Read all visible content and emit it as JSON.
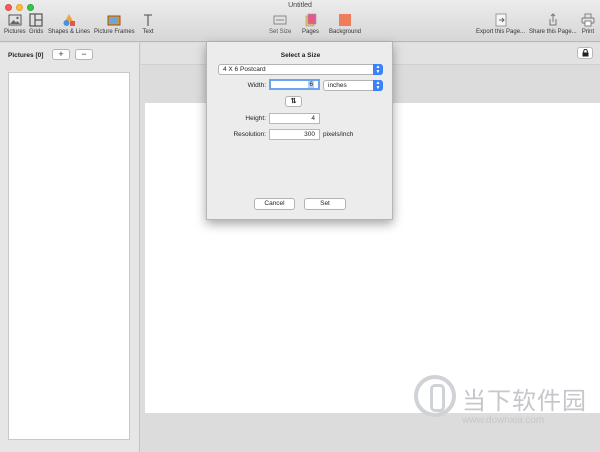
{
  "window": {
    "title": "Untitled"
  },
  "toolbar": {
    "pictures": "Pictures",
    "grids": "Grids",
    "shapes_lines": "Shapes & Lines",
    "picture_frames": "Picture Frames",
    "text": "Text",
    "set_size": "Set Size",
    "pages": "Pages",
    "background": "Background",
    "export_page": "Export this Page...",
    "share_page": "Share this Page...",
    "print": "Print"
  },
  "sidebar": {
    "header": "Pictures [0]",
    "add_label": "+",
    "remove_label": "−"
  },
  "dialog": {
    "title": "Select a Size",
    "preset": "4 X 6 Postcard",
    "width_label": "Width:",
    "width_value": "6",
    "unit": "inches",
    "swap_label": "⇅",
    "height_label": "Height:",
    "height_value": "4",
    "resolution_label": "Resolution:",
    "resolution_value": "300",
    "resolution_unit": "pixels/inch",
    "cancel": "Cancel",
    "set": "Set"
  },
  "watermark": {
    "text": "当下软件园",
    "url": "www.downxia.com"
  },
  "colors": {
    "accent": "#3b82f6",
    "focus_ring": "#6aa6ee",
    "background_swatch": "#ee7d5a"
  },
  "icons": {
    "pictures": "image-icon",
    "grids": "grid-icon",
    "shapes": "shapes-icon",
    "frames": "frame-icon",
    "text": "text-icon",
    "set_size": "resize-icon",
    "pages": "pages-icon",
    "background": "background-swatch-icon",
    "export": "export-icon",
    "share": "share-icon",
    "print": "printer-icon",
    "lock": "lock-icon"
  }
}
